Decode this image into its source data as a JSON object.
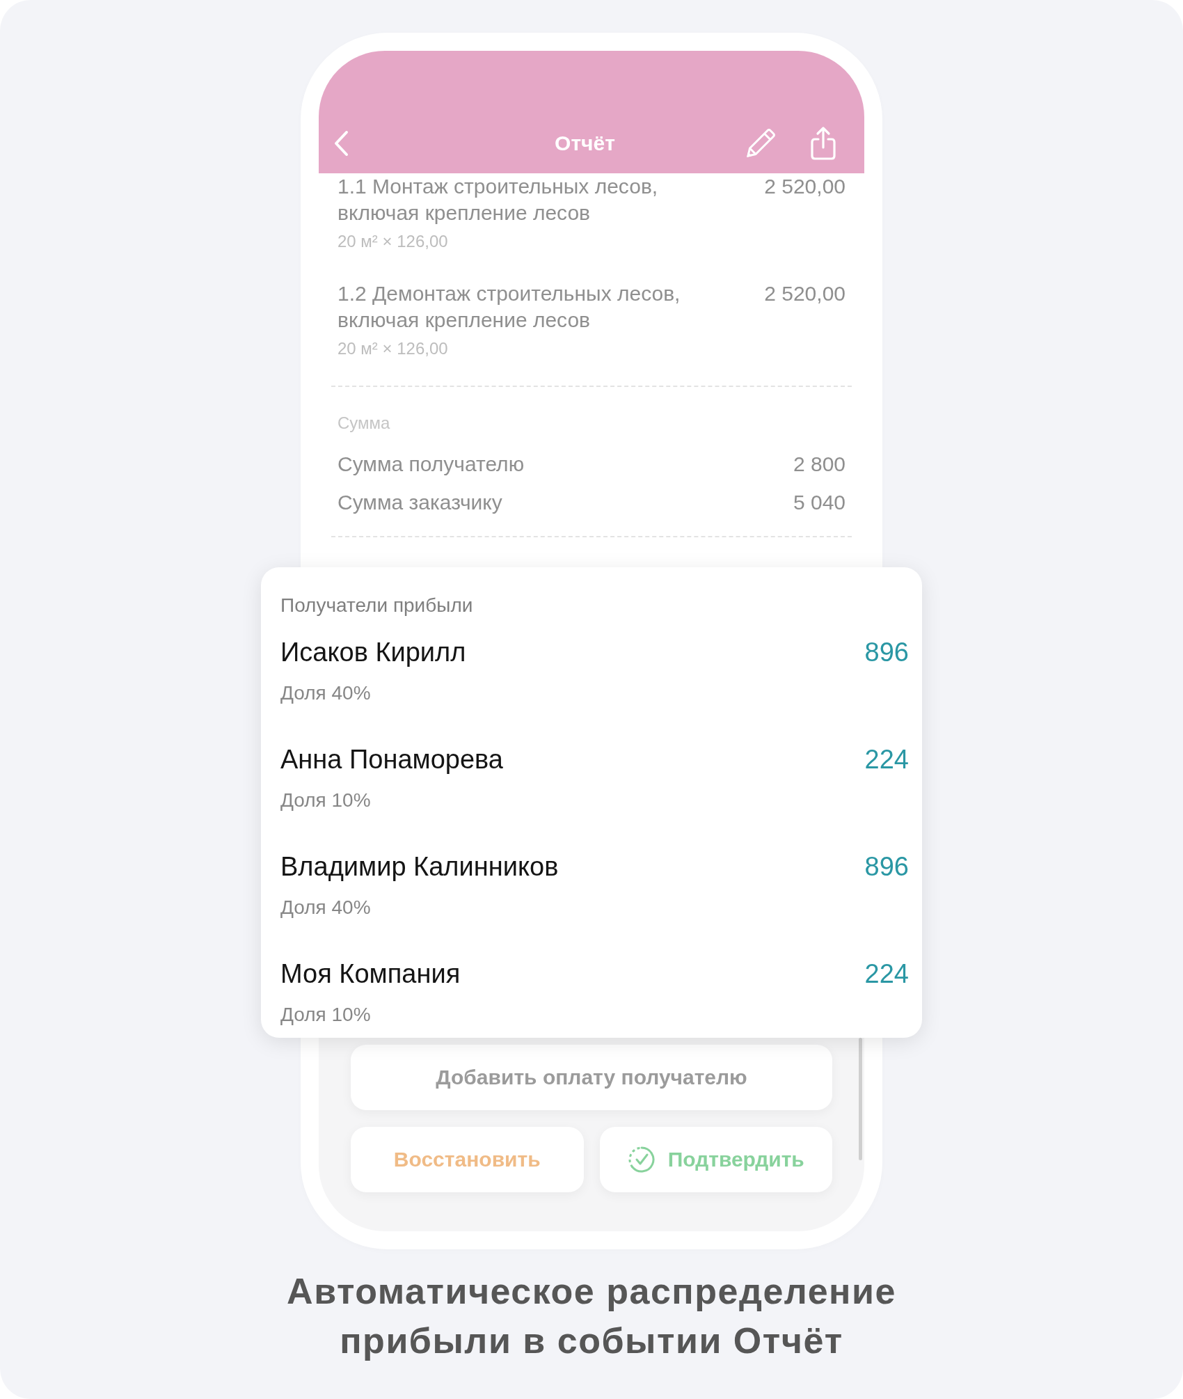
{
  "header": {
    "title": "Отчёт"
  },
  "line_items": [
    {
      "title": "1.1 Монтаж строительных лесов, включая крепление лесов",
      "amount": "2 520,00",
      "detail": "20 м² × 126,00"
    },
    {
      "title": "1.2 Демонтаж строительных лесов, включая крепление лесов",
      "amount": "2 520,00",
      "detail": "20 м² × 126,00"
    }
  ],
  "totals": {
    "label": "Сумма",
    "rows": [
      {
        "label": "Сумма получателю",
        "value": "2 800"
      },
      {
        "label": "Сумма заказчику",
        "value": "5 040"
      }
    ]
  },
  "profit_recipients": {
    "title": "Получатели прибыли",
    "recipients": [
      {
        "name": "Исаков Кирилл",
        "amount": "896",
        "share": "Доля 40%"
      },
      {
        "name": "Анна Понаморева",
        "amount": "224",
        "share": "Доля 10%"
      },
      {
        "name": "Владимир Калинников",
        "amount": "896",
        "share": "Доля 40%"
      },
      {
        "name": "Моя Компания",
        "amount": "224",
        "share": "Доля 10%"
      }
    ]
  },
  "buttons": [
    {
      "label": "Добавить оплату получателю",
      "kind": "neutral"
    },
    {
      "label": "Восстановить",
      "kind": "warning"
    },
    {
      "label": "Подтвердить",
      "kind": "confirm"
    }
  ],
  "caption": "Автоматическое распределение прибыли в событии Отчёт"
}
